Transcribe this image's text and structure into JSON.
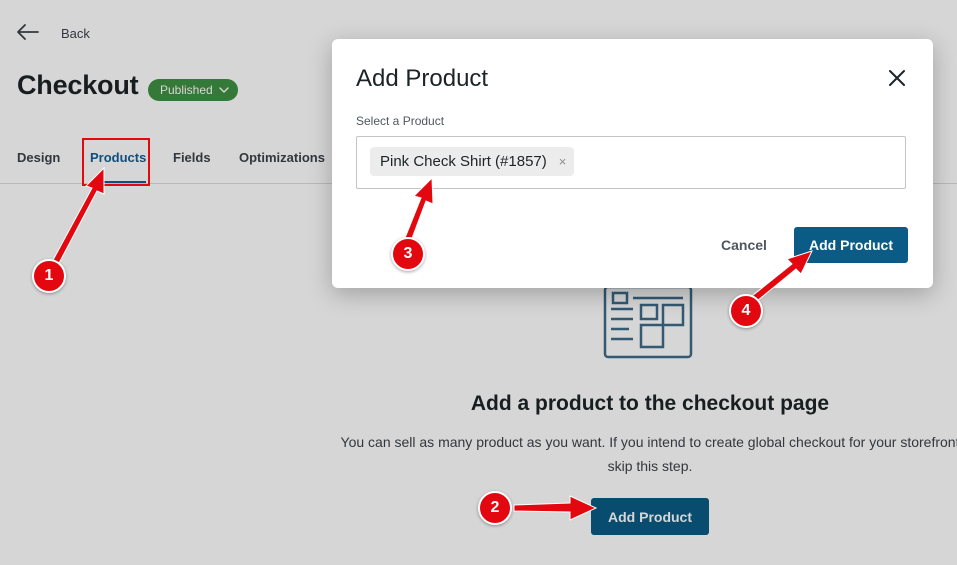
{
  "header": {
    "back_label": "Back",
    "title": "Checkout",
    "status_badge": "Published"
  },
  "tabs": [
    {
      "label": "Design",
      "active": false
    },
    {
      "label": "Products",
      "active": true
    },
    {
      "label": "Fields",
      "active": false
    },
    {
      "label": "Optimizations",
      "active": false
    }
  ],
  "empty_state": {
    "title": "Add a product to the checkout page",
    "description": "You can sell as many product as you want. If you intend to create global checkout for your storefront skip this step.",
    "button_label": "Add Product"
  },
  "modal": {
    "title": "Add Product",
    "field_label": "Select a Product",
    "selected_product": "Pink Check Shirt (#1857)",
    "remove_glyph": "×",
    "cancel_label": "Cancel",
    "confirm_label": "Add Product"
  },
  "annotations": {
    "steps": [
      "1",
      "2",
      "3",
      "4"
    ],
    "color": "#e3080f"
  },
  "colors": {
    "primary_button": "#0a5b85",
    "active_tab": "#135e96",
    "published_badge": "#3f9142",
    "annotation_red": "#e3080f"
  }
}
